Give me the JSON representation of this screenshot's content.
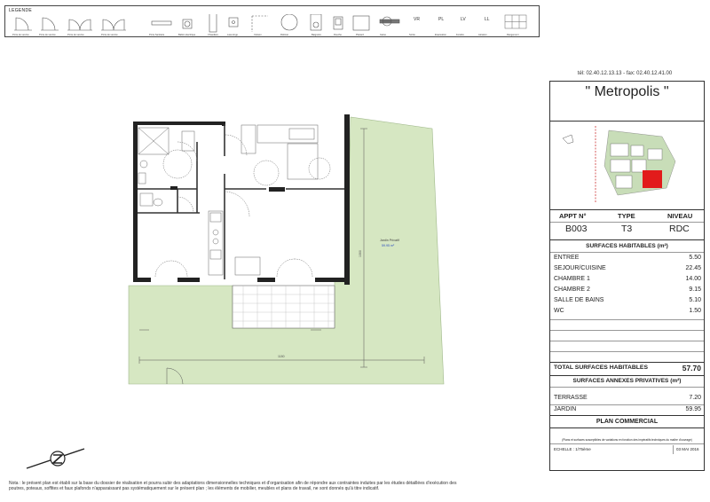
{
  "legend": {
    "title": "LEGENDE",
    "captions": [
      "Porte de service",
      "Porte de service",
      "Porte de service",
      "Porte de service",
      "Porte de service",
      "Porte Sanitaire",
      "Ballon électrique",
      "Chaudière",
      "Lave-linge",
      "Cloison",
      "Robinet",
      "Baignoire",
      "Douche",
      "Placard",
      "Gaine",
      "Sortie",
      "Evacuation",
      "Fenêtre",
      "Aération",
      "Rangement"
    ],
    "abbreviations": [
      "VR",
      "PL",
      "LV",
      "LL"
    ]
  },
  "plan": {
    "garden_label": "Jardin Privatif",
    "garden_area": "59.95 m²",
    "dim_horizontal": "1180",
    "dim_vertical": "1060"
  },
  "contact": "tél: 02.40.12.13.13 - fax: 02.40.12.41.00",
  "project_name": "\" Metropolis \"",
  "apartment": {
    "headers": {
      "appt": "APPT N°",
      "type": "TYPE",
      "level": "NIVEAU"
    },
    "number": "B003",
    "type": "T3",
    "level": "RDC"
  },
  "habitable": {
    "title": "SURFACES HABITABLES (m²)",
    "rows": [
      {
        "label": "ENTREE",
        "value": "5.50"
      },
      {
        "label": "SEJOUR/CUISINE",
        "value": "22.45"
      },
      {
        "label": "CHAMBRE 1",
        "value": "14.00"
      },
      {
        "label": "CHAMBRE 2",
        "value": "9.15"
      },
      {
        "label": "SALLE DE BAINS",
        "value": "5.10"
      },
      {
        "label": "WC",
        "value": "1.50"
      }
    ],
    "total_label": "TOTAL SURFACES HABITABLES",
    "total_value": "57.70"
  },
  "annexes": {
    "title": "SURFACES ANNEXES PRIVATIVES (m²)",
    "rows": [
      {
        "label": "TERRASSE",
        "value": "7.20"
      },
      {
        "label": "JARDIN",
        "value": "59.95"
      }
    ]
  },
  "plan_title": "PLAN COMMERCIAL",
  "disclaimer": "(Plans et surfaces susceptibles de variations en fonction des impératifs techniques du maître d'ouvrage)",
  "scale": "ECHELLE : 1/75ème",
  "date": "03 MAI 2016",
  "note": "Nota : le présent plan est établi sur la base du dossier de réalisation et pourra subir des adaptations dimensionnelles techniques et d'organisation afin de répondre aux contraintes induites par les études détaillées d'exécution des poutres, poteaux, soffites et faux plafonds n'apparaissant pas systématiquement sur le présent plan ; les éléments de mobilier, meubles et plans de travail, ne sont donnés qu'à titre indicatif."
}
